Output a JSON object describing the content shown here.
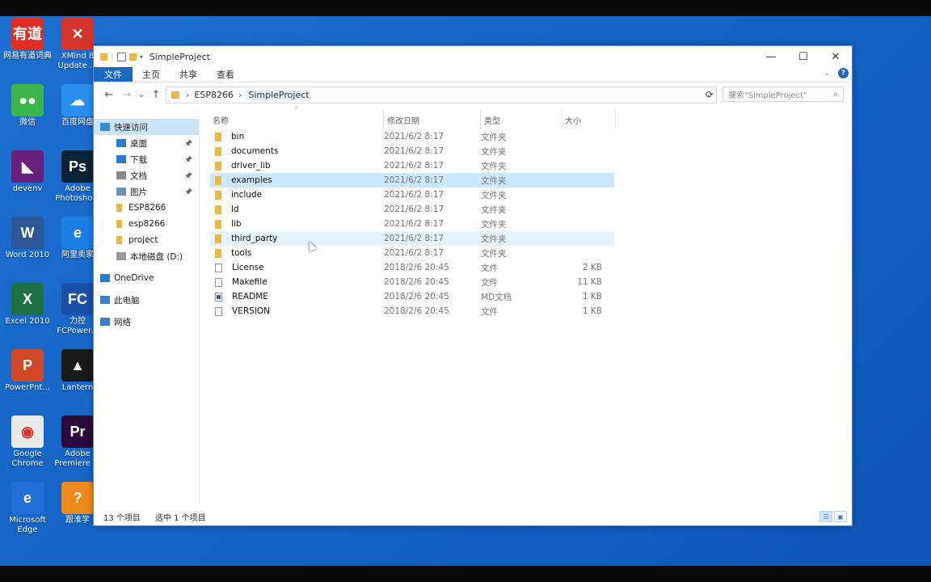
{
  "desktop": {
    "icons": [
      {
        "label": "网易有道词典",
        "label2": "",
        "glyph": "有道",
        "color": "#e02e24"
      },
      {
        "label": "XMind 8",
        "label2": "Update ...",
        "glyph": "✕",
        "color": "#d8332a"
      },
      {
        "label": "微信",
        "label2": "",
        "glyph": "●●",
        "color": "#39b54a"
      },
      {
        "label": "百度网盘",
        "label2": "",
        "glyph": "☁",
        "color": "#2a8ff0"
      },
      {
        "label": "devenv",
        "label2": "",
        "glyph": "◣",
        "color": "#68217a"
      },
      {
        "label": "Adobe",
        "label2": "Photosho...",
        "glyph": "Ps",
        "color": "#0b2337"
      },
      {
        "label": "Word 2010",
        "label2": "",
        "glyph": "W",
        "color": "#2b5797"
      },
      {
        "label": "阿里卖家",
        "label2": "",
        "glyph": "e",
        "color": "#1a7ee6"
      },
      {
        "label": "Excel 2010",
        "label2": "",
        "glyph": "X",
        "color": "#1e7145"
      },
      {
        "label": "力控",
        "label2": "FCPower...",
        "glyph": "FC",
        "color": "#1c4fa8"
      },
      {
        "label": "PowerPnt...",
        "label2": "",
        "glyph": "P",
        "color": "#d24726"
      },
      {
        "label": "Lantern",
        "label2": "",
        "glyph": "▲",
        "color": "#1a1a1a"
      },
      {
        "label": "Google",
        "label2": "Chrome",
        "glyph": "◉",
        "color": "#e9e9e9"
      },
      {
        "label": "Adobe",
        "label2": "Premiere ...",
        "glyph": "Pr",
        "color": "#2a0a3d"
      },
      {
        "label": "Microsoft",
        "label2": "Edge",
        "glyph": "e",
        "color": "#1f6fd6"
      },
      {
        "label": "跟淮学",
        "label2": "",
        "glyph": "?",
        "color": "#f08a1a"
      }
    ]
  },
  "window": {
    "title": "SimpleProject",
    "controls": {
      "minimize": "—",
      "maximize": "☐",
      "close": "✕"
    },
    "ribbon_tabs": [
      "文件",
      "主页",
      "共享",
      "查看"
    ],
    "nav": {
      "back": "←",
      "forward": "→",
      "recent": "⌄",
      "up": "↑"
    },
    "breadcrumb": [
      "ESP8266",
      "SimpleProject"
    ],
    "search_placeholder": "搜索\"SimpleProject\"",
    "sidebar": [
      {
        "label": "快速访问",
        "icon": "star-icon",
        "pinned": false,
        "selected": true,
        "indent": 8
      },
      {
        "label": "桌面",
        "icon": "desktop-icon",
        "pinned": true,
        "selected": false,
        "indent": 28
      },
      {
        "label": "下载",
        "icon": "download-icon",
        "pinned": true,
        "selected": false,
        "indent": 28
      },
      {
        "label": "文档",
        "icon": "document-icon",
        "pinned": true,
        "selected": false,
        "indent": 28
      },
      {
        "label": "图片",
        "icon": "picture-icon",
        "pinned": true,
        "selected": false,
        "indent": 28
      },
      {
        "label": "ESP8266",
        "icon": "folder-icon",
        "pinned": false,
        "selected": false,
        "indent": 28
      },
      {
        "label": "esp8266",
        "icon": "folder-icon",
        "pinned": false,
        "selected": false,
        "indent": 28
      },
      {
        "label": "project",
        "icon": "folder-icon",
        "pinned": false,
        "selected": false,
        "indent": 28
      },
      {
        "label": "本地磁盘 (D:)",
        "icon": "drive-icon",
        "pinned": false,
        "selected": false,
        "indent": 28
      },
      {
        "label": "OneDrive",
        "icon": "cloud-icon",
        "pinned": false,
        "selected": false,
        "indent": 8
      },
      {
        "label": "此电脑",
        "icon": "computer-icon",
        "pinned": false,
        "selected": false,
        "indent": 8
      },
      {
        "label": "网络",
        "icon": "network-icon",
        "pinned": false,
        "selected": false,
        "indent": 8
      }
    ],
    "columns": {
      "name": "名称",
      "date": "修改日期",
      "type": "类型",
      "size": "大小"
    },
    "files": [
      {
        "name": "bin",
        "date": "2021/6/2 8:17",
        "type": "文件夹",
        "size": "",
        "kind": "folder"
      },
      {
        "name": "documents",
        "date": "2021/6/2 8:17",
        "type": "文件夹",
        "size": "",
        "kind": "folder"
      },
      {
        "name": "driver_lib",
        "date": "2021/6/2 8:17",
        "type": "文件夹",
        "size": "",
        "kind": "folder"
      },
      {
        "name": "examples",
        "date": "2021/6/2 8:17",
        "type": "文件夹",
        "size": "",
        "kind": "folder",
        "selected": true
      },
      {
        "name": "include",
        "date": "2021/6/2 8:17",
        "type": "文件夹",
        "size": "",
        "kind": "folder"
      },
      {
        "name": "ld",
        "date": "2021/6/2 8:17",
        "type": "文件夹",
        "size": "",
        "kind": "folder"
      },
      {
        "name": "lib",
        "date": "2021/6/2 8:17",
        "type": "文件夹",
        "size": "",
        "kind": "folder"
      },
      {
        "name": "third_party",
        "date": "2021/6/2 8:17",
        "type": "文件夹",
        "size": "",
        "kind": "folder",
        "hover": true
      },
      {
        "name": "tools",
        "date": "2021/6/2 8:17",
        "type": "文件夹",
        "size": "",
        "kind": "folder"
      },
      {
        "name": "License",
        "date": "2018/2/6 20:45",
        "type": "文件",
        "size": "2 KB",
        "kind": "file"
      },
      {
        "name": "Makefile",
        "date": "2018/2/6 20:45",
        "type": "文件",
        "size": "11 KB",
        "kind": "file"
      },
      {
        "name": "README",
        "date": "2018/2/6 20:45",
        "type": "MD文档",
        "size": "1 KB",
        "kind": "md"
      },
      {
        "name": "VERSION",
        "date": "2018/2/6 20:45",
        "type": "文件",
        "size": "1 KB",
        "kind": "file"
      }
    ],
    "status": {
      "count": "13 个项目",
      "selected": "选中 1 个项目"
    }
  }
}
